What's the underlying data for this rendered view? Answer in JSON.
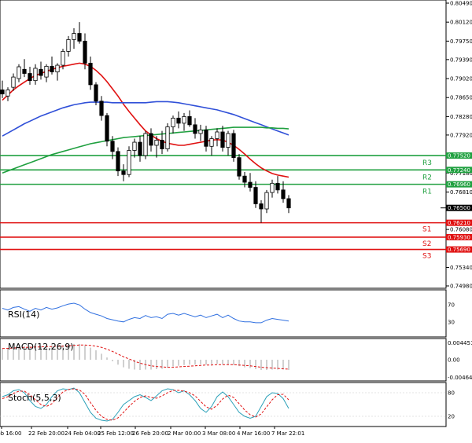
{
  "chart_data": {
    "type": "candlestick",
    "instrument_scale": {
      "ylim": [
        0.7498,
        0.8049
      ]
    },
    "price_ticks": [
      "0.80490",
      "0.80120",
      "0.79750",
      "0.79390",
      "0.79020",
      "0.78650",
      "0.78280",
      "0.77920",
      "0.77180",
      "0.76810",
      "0.76080",
      "0.75340",
      "0.74980"
    ],
    "x_ticks": [
      "9 Feb 16:00",
      "22 Feb 20:00",
      "24 Feb 04:00",
      "25 Feb 12:00",
      "26 Feb 20:00",
      "2 Mar 00:00",
      "3 Mar 08:00",
      "4 Mar 16:00",
      "7 Mar 22:01"
    ],
    "candles": [
      {
        "o": 0.788,
        "h": 0.7898,
        "l": 0.7864,
        "c": 0.7872
      },
      {
        "o": 0.7868,
        "h": 0.7885,
        "l": 0.7858,
        "c": 0.788
      },
      {
        "o": 0.7885,
        "h": 0.7912,
        "l": 0.7878,
        "c": 0.7905
      },
      {
        "o": 0.7902,
        "h": 0.793,
        "l": 0.7895,
        "c": 0.7925
      },
      {
        "o": 0.792,
        "h": 0.794,
        "l": 0.7905,
        "c": 0.7912
      },
      {
        "o": 0.7912,
        "h": 0.7925,
        "l": 0.789,
        "c": 0.7898
      },
      {
        "o": 0.7898,
        "h": 0.793,
        "l": 0.789,
        "c": 0.7922
      },
      {
        "o": 0.792,
        "h": 0.7935,
        "l": 0.79,
        "c": 0.7908
      },
      {
        "o": 0.7905,
        "h": 0.793,
        "l": 0.7895,
        "c": 0.7926
      },
      {
        "o": 0.7926,
        "h": 0.7945,
        "l": 0.791,
        "c": 0.7915
      },
      {
        "o": 0.7915,
        "h": 0.7932,
        "l": 0.7898,
        "c": 0.7928
      },
      {
        "o": 0.7928,
        "h": 0.796,
        "l": 0.792,
        "c": 0.7955
      },
      {
        "o": 0.7955,
        "h": 0.7985,
        "l": 0.7945,
        "c": 0.7978
      },
      {
        "o": 0.7978,
        "h": 0.8,
        "l": 0.796,
        "c": 0.799
      },
      {
        "o": 0.799,
        "h": 0.8012,
        "l": 0.797,
        "c": 0.7975
      },
      {
        "o": 0.7975,
        "h": 0.799,
        "l": 0.792,
        "c": 0.7932
      },
      {
        "o": 0.7932,
        "h": 0.7945,
        "l": 0.788,
        "c": 0.789
      },
      {
        "o": 0.789,
        "h": 0.7895,
        "l": 0.785,
        "c": 0.7858
      },
      {
        "o": 0.7858,
        "h": 0.7868,
        "l": 0.782,
        "c": 0.783
      },
      {
        "o": 0.783,
        "h": 0.7835,
        "l": 0.777,
        "c": 0.778
      },
      {
        "o": 0.778,
        "h": 0.779,
        "l": 0.7745,
        "c": 0.776
      },
      {
        "o": 0.776,
        "h": 0.7768,
        "l": 0.7712,
        "c": 0.7722
      },
      {
        "o": 0.7722,
        "h": 0.7735,
        "l": 0.7702,
        "c": 0.7715
      },
      {
        "o": 0.7715,
        "h": 0.777,
        "l": 0.771,
        "c": 0.7762
      },
      {
        "o": 0.7762,
        "h": 0.7785,
        "l": 0.7748,
        "c": 0.7778
      },
      {
        "o": 0.7778,
        "h": 0.779,
        "l": 0.774,
        "c": 0.7752
      },
      {
        "o": 0.7752,
        "h": 0.78,
        "l": 0.7745,
        "c": 0.7795
      },
      {
        "o": 0.7795,
        "h": 0.7805,
        "l": 0.776,
        "c": 0.7772
      },
      {
        "o": 0.7772,
        "h": 0.779,
        "l": 0.7748,
        "c": 0.7782
      },
      {
        "o": 0.7782,
        "h": 0.78,
        "l": 0.7755,
        "c": 0.7765
      },
      {
        "o": 0.7765,
        "h": 0.7815,
        "l": 0.776,
        "c": 0.7808
      },
      {
        "o": 0.7808,
        "h": 0.783,
        "l": 0.7795,
        "c": 0.7825
      },
      {
        "o": 0.7825,
        "h": 0.7838,
        "l": 0.7805,
        "c": 0.7815
      },
      {
        "o": 0.7815,
        "h": 0.7835,
        "l": 0.78,
        "c": 0.7828
      },
      {
        "o": 0.7828,
        "h": 0.784,
        "l": 0.7808,
        "c": 0.7812
      },
      {
        "o": 0.7812,
        "h": 0.7825,
        "l": 0.7785,
        "c": 0.7795
      },
      {
        "o": 0.7795,
        "h": 0.7812,
        "l": 0.778,
        "c": 0.7802
      },
      {
        "o": 0.7802,
        "h": 0.781,
        "l": 0.776,
        "c": 0.777
      },
      {
        "o": 0.777,
        "h": 0.779,
        "l": 0.7752,
        "c": 0.7785
      },
      {
        "o": 0.7785,
        "h": 0.7805,
        "l": 0.777,
        "c": 0.7798
      },
      {
        "o": 0.7798,
        "h": 0.781,
        "l": 0.776,
        "c": 0.7768
      },
      {
        "o": 0.7768,
        "h": 0.78,
        "l": 0.7752,
        "c": 0.7795
      },
      {
        "o": 0.7795,
        "h": 0.7802,
        "l": 0.774,
        "c": 0.7748
      },
      {
        "o": 0.7748,
        "h": 0.7755,
        "l": 0.7705,
        "c": 0.7712
      },
      {
        "o": 0.7712,
        "h": 0.772,
        "l": 0.769,
        "c": 0.77
      },
      {
        "o": 0.77,
        "h": 0.7718,
        "l": 0.7682,
        "c": 0.769
      },
      {
        "o": 0.769,
        "h": 0.7702,
        "l": 0.765,
        "c": 0.7658
      },
      {
        "o": 0.7658,
        "h": 0.7665,
        "l": 0.7621,
        "c": 0.7648
      },
      {
        "o": 0.7648,
        "h": 0.7685,
        "l": 0.764,
        "c": 0.768
      },
      {
        "o": 0.768,
        "h": 0.7705,
        "l": 0.767,
        "c": 0.7698
      },
      {
        "o": 0.7698,
        "h": 0.7712,
        "l": 0.7678,
        "c": 0.7685
      },
      {
        "o": 0.7685,
        "h": 0.7702,
        "l": 0.766,
        "c": 0.7668
      },
      {
        "o": 0.7668,
        "h": 0.7675,
        "l": 0.764,
        "c": 0.765
      }
    ],
    "moving_averages": [
      {
        "color": "#e01010",
        "values": [
          0.786,
          0.787,
          0.788,
          0.7888,
          0.7895,
          0.7902,
          0.7908,
          0.7912,
          0.7916,
          0.792,
          0.7923,
          0.7926,
          0.7928,
          0.793,
          0.7932,
          0.793,
          0.7926,
          0.7918,
          0.7908,
          0.7896,
          0.7882,
          0.7868,
          0.7852,
          0.7838,
          0.7825,
          0.7812,
          0.78,
          0.7792,
          0.7785,
          0.778,
          0.7776,
          0.7774,
          0.7772,
          0.7772,
          0.7774,
          0.7776,
          0.7778,
          0.778,
          0.7782,
          0.7783,
          0.7782,
          0.7778,
          0.7772,
          0.7764,
          0.7755,
          0.7745,
          0.7736,
          0.7728,
          0.7722,
          0.7717,
          0.7714,
          0.7712,
          0.771
        ]
      },
      {
        "color": "#3050d8",
        "values": [
          0.779,
          0.7796,
          0.7802,
          0.7808,
          0.7814,
          0.7819,
          0.7824,
          0.7829,
          0.7833,
          0.7837,
          0.7841,
          0.7845,
          0.7848,
          0.7851,
          0.7853,
          0.7855,
          0.7856,
          0.7856,
          0.7856,
          0.7856,
          0.7855,
          0.7855,
          0.7855,
          0.7855,
          0.7855,
          0.7855,
          0.7855,
          0.7856,
          0.7857,
          0.7857,
          0.7857,
          0.7856,
          0.7855,
          0.7853,
          0.7851,
          0.7849,
          0.7847,
          0.7845,
          0.7843,
          0.7841,
          0.7838,
          0.7835,
          0.7832,
          0.7828,
          0.7824,
          0.782,
          0.7816,
          0.7812,
          0.7808,
          0.7804,
          0.78,
          0.7796,
          0.7792
        ]
      },
      {
        "color": "#20a040",
        "values": [
          0.7718,
          0.7722,
          0.7726,
          0.773,
          0.7734,
          0.7738,
          0.7742,
          0.7746,
          0.775,
          0.7754,
          0.7757,
          0.776,
          0.7763,
          0.7766,
          0.7769,
          0.7772,
          0.7775,
          0.7777,
          0.7779,
          0.7781,
          0.7783,
          0.7785,
          0.7787,
          0.7788,
          0.7789,
          0.779,
          0.7791,
          0.7792,
          0.7793,
          0.7794,
          0.7795,
          0.7796,
          0.7797,
          0.7798,
          0.7799,
          0.78,
          0.7801,
          0.7802,
          0.7803,
          0.7804,
          0.7805,
          0.7806,
          0.7807,
          0.7807,
          0.7807,
          0.7807,
          0.7807,
          0.7807,
          0.7806,
          0.7806,
          0.7805,
          0.7805,
          0.7804
        ]
      }
    ],
    "current_price": {
      "value": 0.765,
      "label": "0.76500"
    },
    "resistance": [
      {
        "name": "R3",
        "value": 0.7752,
        "label": "0.77520"
      },
      {
        "name": "R2",
        "value": 0.7724,
        "label": "0.77240"
      },
      {
        "name": "R1",
        "value": 0.7696,
        "label": "0.76960"
      }
    ],
    "support": [
      {
        "name": "S1",
        "value": 0.7621,
        "label": "0.76210"
      },
      {
        "name": "S2",
        "value": 0.7593,
        "label": "0.75930"
      },
      {
        "name": "S3",
        "value": 0.7569,
        "label": "0.75690"
      }
    ],
    "colors": {
      "resistance": "#20a040",
      "support": "#e01010",
      "bull_body": "#ffffff",
      "bear_body": "#000000"
    },
    "indicators": [
      {
        "name": "RSI(14)",
        "ticks": [
          "70",
          "30"
        ],
        "ylim": [
          0,
          100
        ],
        "color": "#3070e0",
        "values": [
          62,
          58,
          64,
          66,
          60,
          55,
          62,
          58,
          64,
          60,
          63,
          68,
          72,
          74,
          70,
          60,
          52,
          48,
          44,
          38,
          35,
          32,
          30,
          36,
          40,
          38,
          45,
          40,
          42,
          38,
          48,
          50,
          46,
          50,
          46,
          42,
          46,
          40,
          44,
          48,
          40,
          46,
          38,
          32,
          30,
          30,
          28,
          28,
          34,
          38,
          36,
          34,
          32
        ]
      },
      {
        "name": "MACD(12,26,9)",
        "ticks": [
          "0.004451",
          "0.00",
          "-0.004646"
        ],
        "ylim": [
          -0.005,
          0.005
        ],
        "signal_color": "#e01010",
        "histogram": [
          0.003,
          0.0031,
          0.0033,
          0.0035,
          0.0036,
          0.0036,
          0.0037,
          0.0037,
          0.0038,
          0.0038,
          0.0038,
          0.0039,
          0.0041,
          0.0042,
          0.0042,
          0.0038,
          0.0032,
          0.0025,
          0.0016,
          0.0006,
          -0.0004,
          -0.0013,
          -0.002,
          -0.0024,
          -0.0026,
          -0.0027,
          -0.0026,
          -0.0026,
          -0.0025,
          -0.0024,
          -0.0021,
          -0.0018,
          -0.0016,
          -0.0014,
          -0.0013,
          -0.0013,
          -0.0012,
          -0.0013,
          -0.0012,
          -0.0011,
          -0.0012,
          -0.0012,
          -0.0014,
          -0.0017,
          -0.002,
          -0.0022,
          -0.0025,
          -0.0027,
          -0.0027,
          -0.0026,
          -0.0026,
          -0.0026,
          -0.0027
        ],
        "signal": [
          0.003,
          0.003,
          0.0031,
          0.0032,
          0.0033,
          0.0033,
          0.0034,
          0.0034,
          0.0035,
          0.0035,
          0.0036,
          0.0036,
          0.0037,
          0.0038,
          0.0039,
          0.0039,
          0.0038,
          0.0036,
          0.0033,
          0.0028,
          0.0022,
          0.0015,
          0.0008,
          0.0002,
          -0.0004,
          -0.0009,
          -0.0013,
          -0.0016,
          -0.0018,
          -0.0019,
          -0.002,
          -0.002,
          -0.0019,
          -0.0018,
          -0.0017,
          -0.0016,
          -0.0015,
          -0.0014,
          -0.0014,
          -0.0013,
          -0.0013,
          -0.0013,
          -0.0013,
          -0.0014,
          -0.0015,
          -0.0016,
          -0.0018,
          -0.002,
          -0.0021,
          -0.0022,
          -0.0023,
          -0.0024,
          -0.0025
        ]
      },
      {
        "name": "Stoch(5,5,3)",
        "ticks": [
          "80",
          "20"
        ],
        "ylim": [
          0,
          100
        ],
        "main_color": "#2aa0b8",
        "signal_color": "#e01010",
        "main": [
          70,
          75,
          85,
          88,
          80,
          60,
          45,
          40,
          50,
          70,
          85,
          90,
          88,
          92,
          80,
          55,
          30,
          15,
          10,
          8,
          12,
          30,
          50,
          60,
          70,
          75,
          68,
          60,
          72,
          85,
          90,
          88,
          80,
          85,
          75,
          60,
          40,
          30,
          45,
          70,
          82,
          70,
          50,
          30,
          20,
          15,
          20,
          45,
          70,
          80,
          78,
          65,
          40
        ],
        "signal": [
          65,
          70,
          78,
          84,
          84,
          75,
          62,
          50,
          45,
          52,
          68,
          82,
          88,
          90,
          87,
          76,
          55,
          35,
          20,
          12,
          10,
          16,
          30,
          45,
          58,
          68,
          72,
          68,
          66,
          72,
          80,
          86,
          86,
          84,
          80,
          72,
          58,
          44,
          38,
          48,
          64,
          74,
          68,
          52,
          36,
          24,
          18,
          26,
          44,
          62,
          75,
          76,
          62
        ]
      }
    ]
  }
}
